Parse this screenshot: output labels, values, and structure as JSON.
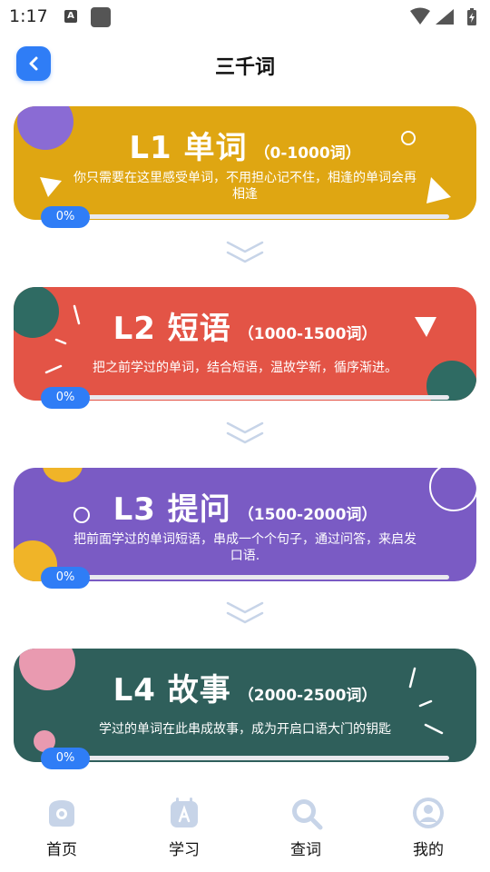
{
  "status_bar": {
    "time": "1:17",
    "app_icon_letter": "A"
  },
  "header": {
    "title": "三千词"
  },
  "levels": [
    {
      "level": "L1 单词",
      "range": "（0-1000词）",
      "description": "你只需要在这里感受单词，不用担心记不住，相逢的单词会再相逢",
      "progress_label": "0%",
      "progress": 0,
      "color": "#dfa612"
    },
    {
      "level": "L2 短语",
      "range": "（1000-1500词）",
      "description": "把之前学过的单词，结合短语，温故学新，循序渐进。",
      "progress_label": "0%",
      "progress": 0,
      "color": "#e35446"
    },
    {
      "level": "L3 提问",
      "range": "（1500-2000词）",
      "description": "把前面学过的单词短语，串成一个个句子，通过问答，来启发口语.",
      "progress_label": "0%",
      "progress": 0,
      "color": "#7a5bc4"
    },
    {
      "level": "L4 故事",
      "range": "（2000-2500词）",
      "description": "学过的单词在此串成故事，成为开启口语大门的钥匙",
      "progress_label": "0%",
      "progress": 0,
      "color": "#2f5f5b"
    }
  ],
  "bottom_nav": {
    "items": [
      {
        "label": "首页",
        "icon": "home-icon"
      },
      {
        "label": "学习",
        "icon": "learn-icon"
      },
      {
        "label": "查词",
        "icon": "search-word-icon"
      },
      {
        "label": "我的",
        "icon": "profile-icon"
      }
    ],
    "icon_color": "#c7d4e8",
    "accent": "#2f7df6"
  }
}
